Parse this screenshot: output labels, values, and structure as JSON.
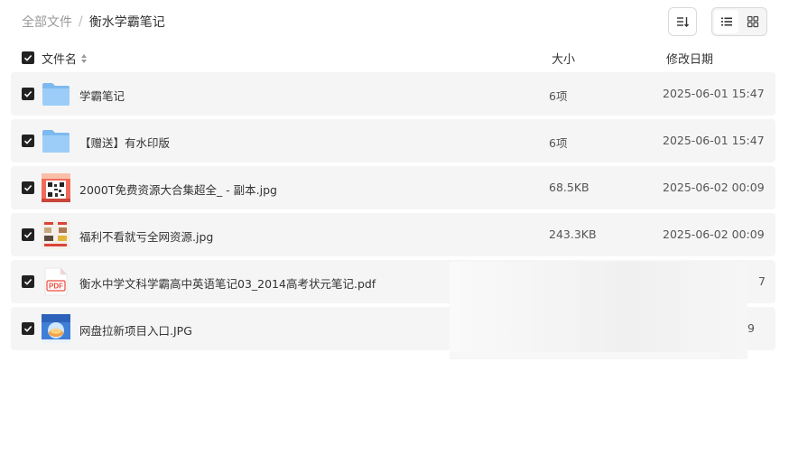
{
  "breadcrumb": {
    "root": "全部文件",
    "separator": "/",
    "current": "衡水学霸笔记"
  },
  "toolbar": {
    "sort_icon": "sort-icon",
    "list_view_icon": "list-view-icon",
    "grid_view_icon": "grid-view-icon",
    "active_view": "list"
  },
  "columns": {
    "name": "文件名",
    "size": "大小",
    "date": "修改日期"
  },
  "files": [
    {
      "name": "学霸笔记",
      "size": "6项",
      "date": "2025-06-01 15:47",
      "type": "folder"
    },
    {
      "name": "【赠送】有水印版",
      "size": "6项",
      "date": "2025-06-01 15:47",
      "type": "folder"
    },
    {
      "name": "2000T免费资源大合集超全_ - 副本.jpg",
      "size": "68.5KB",
      "date": "2025-06-02 00:09",
      "type": "image-qr"
    },
    {
      "name": "福利不看就亏全网资源.jpg",
      "size": "243.3KB",
      "date": "2025-06-02 00:09",
      "type": "image-poster"
    },
    {
      "name": "衡水中学文科学霸高中英语笔记03_2014高考状元笔记.pdf",
      "size": "",
      "date": "7",
      "type": "pdf"
    },
    {
      "name": "网盘拉新项目入口.JPG",
      "size": "",
      "date": "9",
      "type": "image-app"
    }
  ],
  "pdf_label": "PDF",
  "colors": {
    "folder": "#8cc3f5",
    "checkbox": "#222222",
    "row_bg": "#f5f5f6",
    "pdf_red": "#e94b3c"
  }
}
